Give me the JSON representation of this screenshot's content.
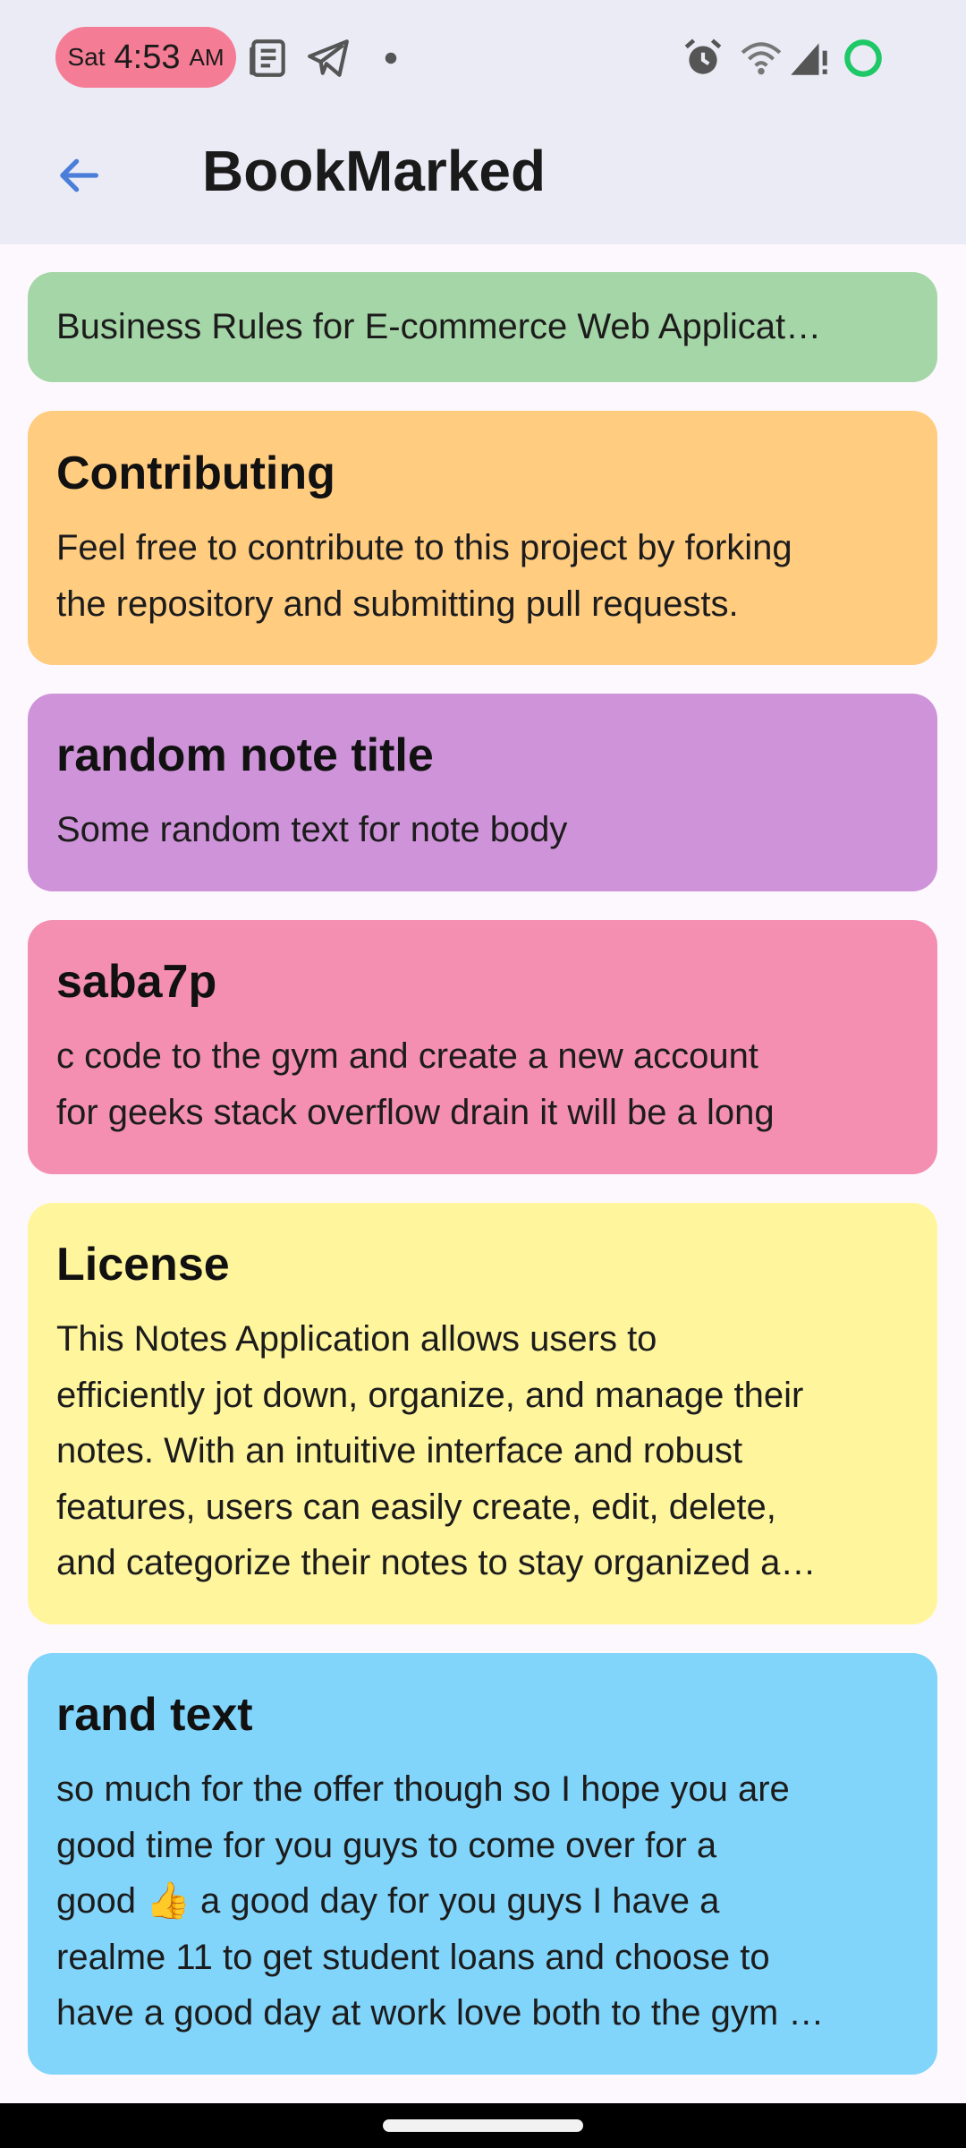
{
  "status_bar": {
    "day": "Sat",
    "time": "4:53",
    "ampm": "AM",
    "left_icons": [
      "news-icon",
      "telegram-icon",
      "dot-icon"
    ],
    "right_icons": [
      "alarm-icon",
      "wifi-icon",
      "signal-icon",
      "battery-ring-icon"
    ],
    "battery_color": "#1ec866"
  },
  "app_bar": {
    "title": "BookMarked",
    "back_icon": "arrow-left-icon",
    "accent": "#4a7ed9"
  },
  "notes": [
    {
      "title": "",
      "body": "Business Rules for E-commerce Web Applicat…",
      "color": "#a5d6a7"
    },
    {
      "title": "Contributing",
      "body_lines": [
        "Feel free to contribute to this project by forking",
        "the repository and submitting pull requests."
      ],
      "color": "#ffcc80"
    },
    {
      "title": "random note title",
      "body_lines": [
        "Some random text for note body"
      ],
      "color": "#ce93d8"
    },
    {
      "title": "saba7p",
      "body_lines": [
        "c code to the gym and create a new account",
        "for geeks stack overflow drain it will be a long"
      ],
      "color": "#f48fb1"
    },
    {
      "title": "License",
      "body_lines": [
        "This Notes Application allows users to",
        "efficiently jot down, organize, and manage their",
        "notes. With an intuitive interface and robust",
        "features, users can easily create, edit, delete,",
        "and categorize their notes to stay organized a…"
      ],
      "color": "#fff59d"
    },
    {
      "title": "rand text",
      "body_lines": [
        "so much for the offer though so I hope you are",
        "good time for you guys to come over for a",
        "good 👍 a good day for you guys I have a",
        "realme 11 to get student loans and choose to",
        "have a good day at work love both to the gym …"
      ],
      "color": "#81d4fa"
    }
  ]
}
